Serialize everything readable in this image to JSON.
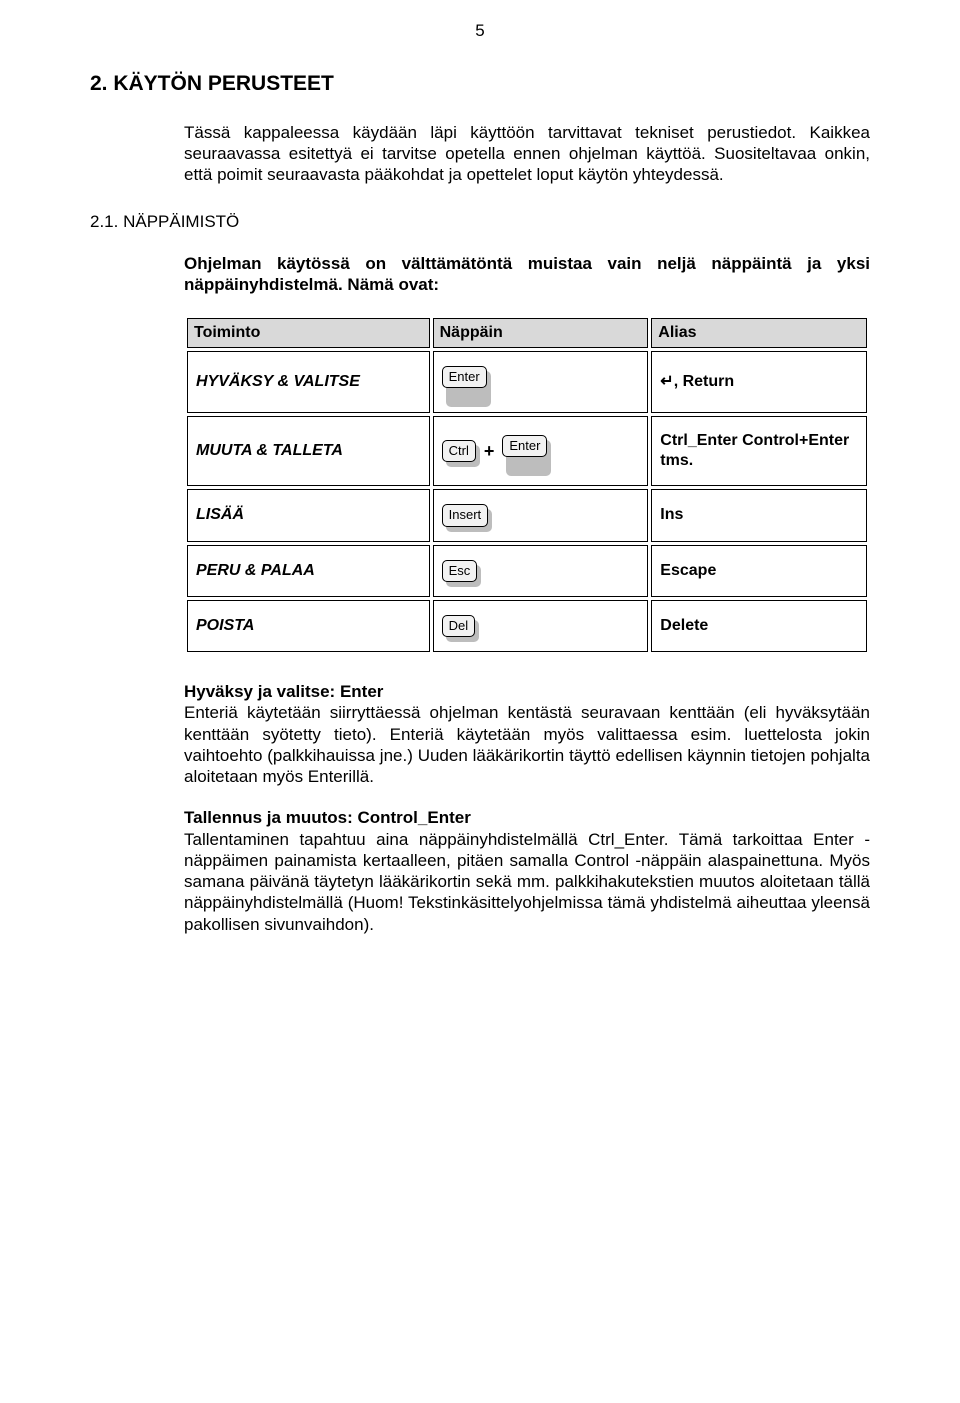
{
  "page_number": "5",
  "heading": "2. KÄYTÖN PERUSTEET",
  "intro": "Tässä kappaleessa käydään läpi käyttöön tarvittavat tekniset perustiedot. Kaikkea seuraavassa esitettyä ei tarvitse opetella ennen ohjelman käyttöä. Suositeltavaa onkin, että poimit seuraavasta pääkohdat ja opettelet loput käytön yhteydessä.",
  "subheading": "2.1. NÄPPÄIMISTÖ",
  "subintro": "Ohjelman käytössä on välttämätöntä muistaa vain neljä näppäintä ja yksi näppäinyhdistelmä. Nämä ovat:",
  "table": {
    "headers": {
      "c1": "Toiminto",
      "c2": "Näppäin",
      "c3": "Alias"
    },
    "rows": [
      {
        "action": "HYVÄKSY & VALITSE",
        "keys": [
          "Enter"
        ],
        "tall": true,
        "alias": "↵, Return"
      },
      {
        "action": "MUUTA & TALLETA",
        "keys": [
          "Ctrl",
          "Enter"
        ],
        "tall_second": true,
        "alias": "Ctrl_Enter Control+Enter tms."
      },
      {
        "action": "LISÄÄ",
        "keys": [
          "Insert"
        ],
        "alias": "Ins"
      },
      {
        "action": "PERU & PALAA",
        "keys": [
          "Esc"
        ],
        "alias": "Escape"
      },
      {
        "action": "POISTA",
        "keys": [
          "Del"
        ],
        "alias": "Delete"
      }
    ]
  },
  "sections": [
    {
      "title": "Hyväksy ja valitse: Enter",
      "body": "Enteriä käytetään siirryttäessä ohjelman kentästä seuravaan kenttään (eli hyväksytään kenttään syötetty tieto). Enteriä käytetään myös valittaessa esim. luettelosta jokin vaihtoehto (palkkihauissa jne.) Uuden lääkärikortin täyttö edellisen käynnin tietojen pohjalta aloitetaan myös Enterillä."
    },
    {
      "title": "Tallennus ja muutos: Control_Enter",
      "body": "Tallentaminen tapahtuu aina näppäinyhdistelmällä Ctrl_Enter. Tämä tarkoittaa Enter -näppäimen painamista kertaalleen, pitäen samalla Control -näppäin alaspainettuna. Myös samana päivänä täytetyn lääkärikortin sekä mm. palkkihakutekstien muutos aloitetaan tällä näppäinyhdistelmällä (Huom! Tekstinkäsittelyohjelmissa tämä yhdistelmä aiheuttaa yleensä pakollisen sivunvaihdon)."
    }
  ]
}
